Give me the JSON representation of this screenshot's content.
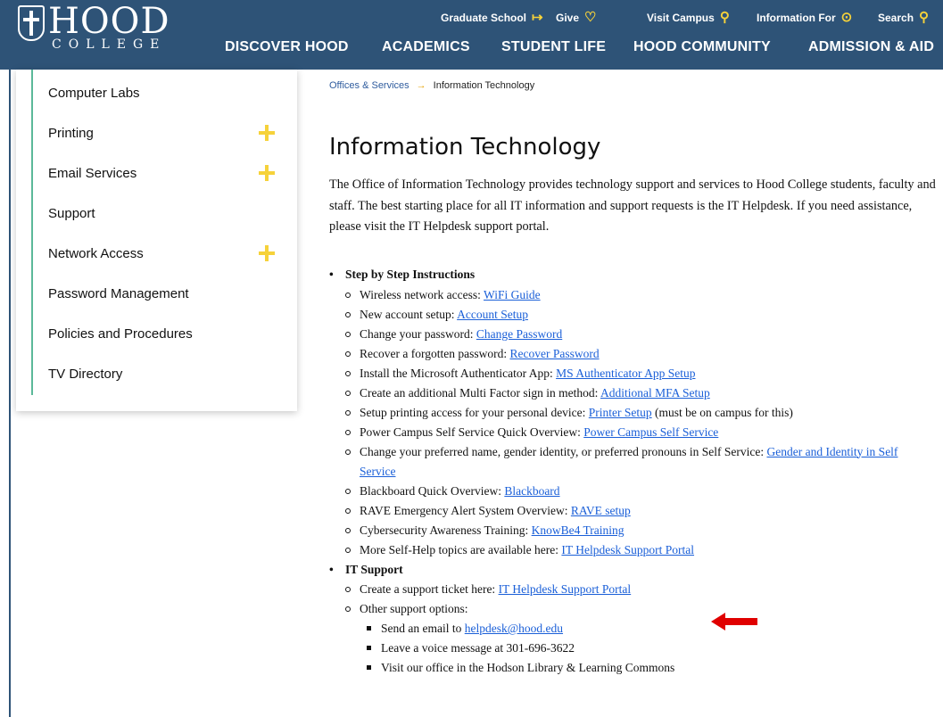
{
  "brand": {
    "logo_word": "HOOD",
    "logo_sub": "COLLEGE"
  },
  "utility_nav": [
    {
      "label": "Graduate School",
      "icon": "arrow-circle-icon",
      "glyph": "↦"
    },
    {
      "label": "Give",
      "icon": "heart-icon",
      "glyph": "♡"
    },
    {
      "label": "Visit Campus",
      "icon": "location-pin-icon",
      "glyph": "⚲"
    },
    {
      "label": "Information For",
      "icon": "chevron-down-circle-icon",
      "glyph": "⊙"
    },
    {
      "label": "Search",
      "icon": "search-icon",
      "glyph": "⚲"
    }
  ],
  "main_nav": [
    "DISCOVER HOOD",
    "ACADEMICS",
    "STUDENT LIFE",
    "HOOD COMMUNITY",
    "ADMISSION & AID"
  ],
  "sidebar": {
    "items": [
      {
        "label": "Computer Labs",
        "expandable": false
      },
      {
        "label": "Printing",
        "expandable": true
      },
      {
        "label": "Email Services",
        "expandable": true
      },
      {
        "label": "Support",
        "expandable": false
      },
      {
        "label": "Network Access",
        "expandable": true
      },
      {
        "label": "Password Management",
        "expandable": false
      },
      {
        "label": "Policies and Procedures",
        "expandable": false
      },
      {
        "label": "TV Directory",
        "expandable": false
      }
    ]
  },
  "breadcrumb": {
    "parent": "Offices & Services",
    "arrow": "→",
    "current": "Information Technology"
  },
  "page": {
    "title": "Information Technology",
    "intro": "The Office of Information Technology provides technology support and services to Hood College students, faculty and staff. The best starting place for all IT information and support requests is the IT Helpdesk.  If you need assistance, please visit the IT Helpdesk support portal."
  },
  "sections": {
    "steps": {
      "heading": "Step by Step Instructions",
      "items": [
        {
          "text": "Wireless network access: ",
          "link": "WiFi Guide",
          "after": ""
        },
        {
          "text": "New account setup: ",
          "link": "Account Setup",
          "after": ""
        },
        {
          "text": "Change your password:  ",
          "link": "Change Password",
          "after": ""
        },
        {
          "text": "Recover a forgotten password:  ",
          "link": "Recover Password",
          "after": ""
        },
        {
          "text": "Install the Microsoft Authenticator App:  ",
          "link": "MS Authenticator App Setup",
          "after": ""
        },
        {
          "text": "Create an additional Multi Factor sign in method:  ",
          "link": "Additional MFA Setup",
          "after": ""
        },
        {
          "text": "Setup printing access for your personal device:  ",
          "link": "Printer Setup",
          "after": " (must be on campus for this)"
        },
        {
          "text": "Power Campus Self Service Quick Overview:  ",
          "link": "Power Campus Self Service",
          "after": ""
        },
        {
          "text": "Change your preferred name, gender identity, or preferred pronouns in Self Service:  ",
          "link": "Gender and Identity in Self Service",
          "after": ""
        },
        {
          "text": "Blackboard Quick Overview:  ",
          "link": "Blackboard",
          "after": ""
        },
        {
          "text": "RAVE Emergency Alert System Overview:  ",
          "link": "RAVE setup",
          "after": ""
        },
        {
          "text": "Cybersecurity Awareness Training: ",
          "link": "KnowBe4 Training",
          "after": ""
        },
        {
          "text": "More Self-Help topics are available here: ",
          "link": "IT Helpdesk Support Portal",
          "after": ""
        }
      ]
    },
    "support": {
      "heading": "IT Support",
      "ticket": {
        "text": "Create a support ticket here:  ",
        "link": "IT Helpdesk Support Portal"
      },
      "other_label": "Other support options:",
      "email": {
        "text": "Send an email to ",
        "link": "helpdesk@hood.edu"
      },
      "voice": "Leave a voice message at 301-696-3622",
      "visit": "Visit our office in the Hodson Library & Learning Commons"
    }
  },
  "colors": {
    "header": "#2e5377",
    "accent_yellow": "#f6d23a",
    "link": "#1a5fd8",
    "annotation_arrow": "#e00000"
  }
}
